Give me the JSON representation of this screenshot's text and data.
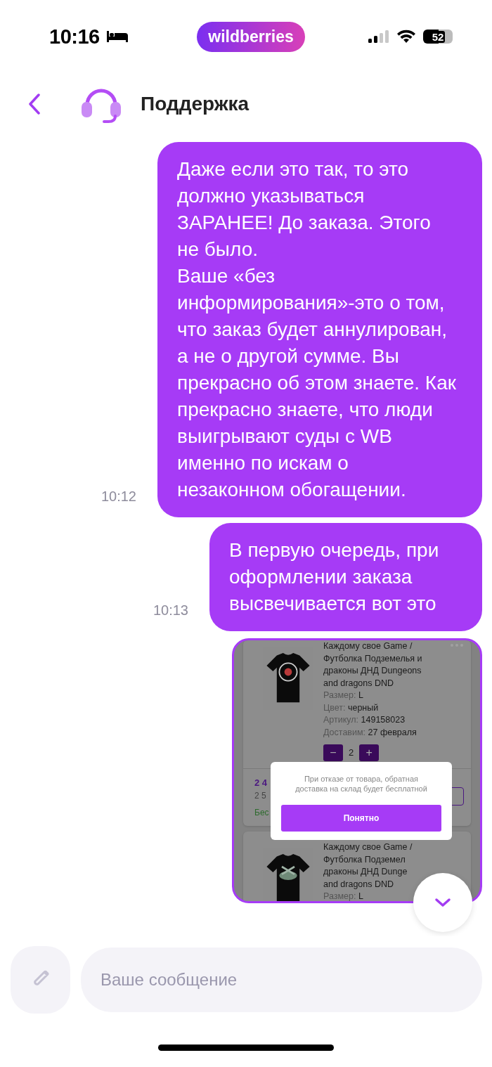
{
  "status_bar": {
    "time": "10:16",
    "brand": "wildberries",
    "battery": "52"
  },
  "header": {
    "title": "Поддержка"
  },
  "messages": [
    {
      "kind": "text",
      "time": "10:12",
      "text": "Даже если это так, то это должно указываться ЗАРАНЕЕ! До заказа. Этого не было.\nВаше «без информирования»-это о том, что заказ будет аннулирован, а не о другой сумме. Вы прекрасно об этом знаете. Как прекрасно знаете, что люди выигрывают суды с WB именно по искам о незаконном обогащении."
    },
    {
      "kind": "text",
      "time": "10:13",
      "text": "В первую очередь, при оформлении заказа высвечивается вот это"
    },
    {
      "kind": "screenshot",
      "products": [
        {
          "title_lines": [
            "Каждому свое Game /",
            "Футболка Подземелья и",
            "драконы ДНД Dungeons",
            "and dragons DND"
          ],
          "details": [
            {
              "label": "Размер:",
              "value": "L"
            },
            {
              "label": "Цвет:",
              "value": "черный"
            },
            {
              "label": "Артикул:",
              "value": "149158023"
            },
            {
              "label": "Доставим:",
              "value": "27 февраля"
            }
          ],
          "quantity": "2",
          "minus": "−",
          "plus": "+",
          "price": "2 4",
          "old_price": "2 5",
          "note": "Бес"
        },
        {
          "title_lines": [
            "Каждому свое Game /",
            "Футболка Подземел",
            "драконы ДНД Dunge",
            "and dragons DND"
          ],
          "details": [
            {
              "label": "Размер:",
              "value": "L"
            }
          ]
        }
      ],
      "dialog": {
        "text": "При отказе от товара, обратная доставка на склад будет бесплатной",
        "button": "Понятно"
      }
    }
  ],
  "composer": {
    "placeholder": "Ваше сообщение"
  }
}
